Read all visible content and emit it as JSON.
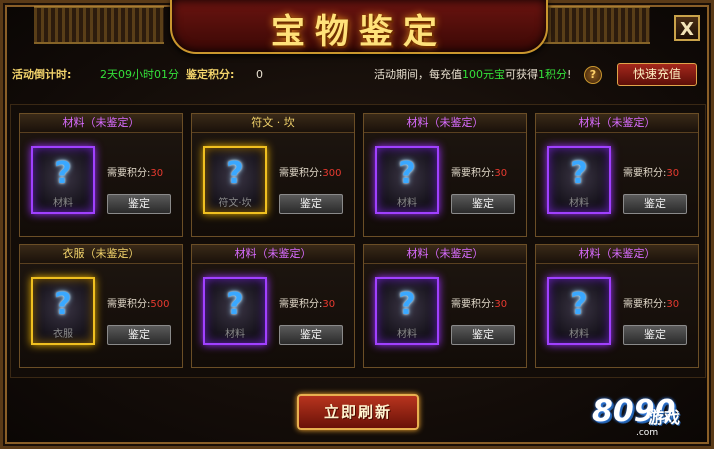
{
  "window": {
    "title": "宝物鉴定",
    "close_label": "X"
  },
  "info": {
    "countdown_label": "活动倒计时:",
    "countdown_value": "2天09小时01分",
    "score_label": "鉴定积分:",
    "score_value": "0",
    "promo_prefix": "活动期间，每充值",
    "promo_amount": "100元宝",
    "promo_mid": "可获得",
    "promo_points": "1积分",
    "promo_suffix": "!",
    "help_label": "?",
    "recharge_label": "快速充值"
  },
  "req_label": "需要积分:",
  "appraise_label": "鉴定",
  "cards": [
    {
      "title": "材料（未鉴定）",
      "title_color": "#d86cff",
      "item": "材料",
      "points": "30",
      "quality": "purple"
    },
    {
      "title": "符文 · 坎",
      "title_color": "#f2d36b",
      "item": "符文·坎",
      "points": "300",
      "quality": "gold"
    },
    {
      "title": "材料（未鉴定）",
      "title_color": "#d86cff",
      "item": "材料",
      "points": "30",
      "quality": "purple"
    },
    {
      "title": "材料（未鉴定）",
      "title_color": "#d86cff",
      "item": "材料",
      "points": "30",
      "quality": "purple"
    },
    {
      "title": "衣服（未鉴定）",
      "title_color": "#f2d36b",
      "item": "衣服",
      "points": "500",
      "quality": "gold"
    },
    {
      "title": "材料（未鉴定）",
      "title_color": "#d86cff",
      "item": "材料",
      "points": "30",
      "quality": "purple"
    },
    {
      "title": "材料（未鉴定）",
      "title_color": "#d86cff",
      "item": "材料",
      "points": "30",
      "quality": "purple"
    },
    {
      "title": "材料（未鉴定）",
      "title_color": "#d86cff",
      "item": "材料",
      "points": "30",
      "quality": "purple"
    }
  ],
  "refresh_label": "立即刷新",
  "logo": {
    "main": "8090",
    "sub": "游戏",
    "domain": ".com"
  }
}
